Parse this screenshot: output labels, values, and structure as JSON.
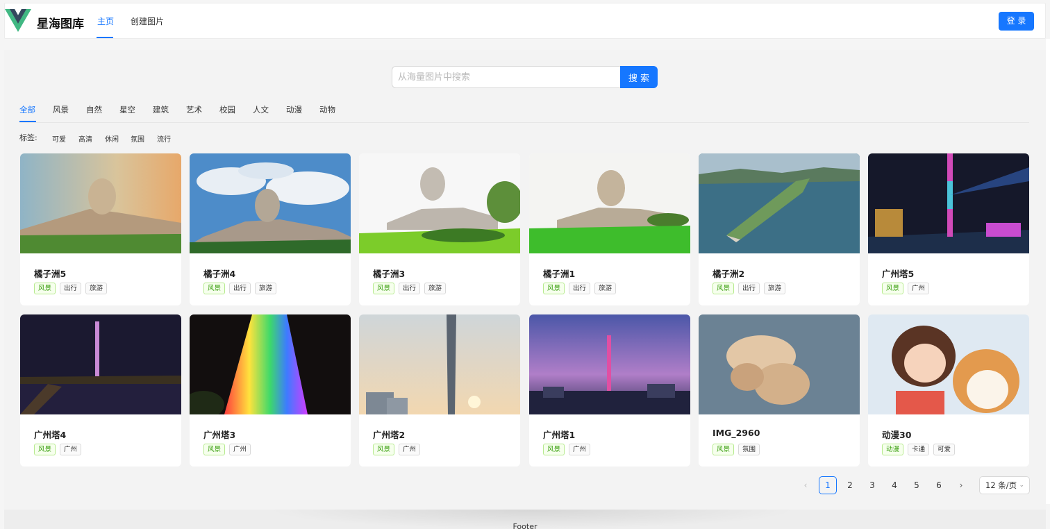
{
  "header": {
    "brand": "星海图库",
    "nav": [
      "主页",
      "创建图片"
    ],
    "login_label": "登 录"
  },
  "search": {
    "placeholder": "从海量图片中搜索",
    "button_label": "搜 索"
  },
  "categories": [
    "全部",
    "风景",
    "自然",
    "星空",
    "建筑",
    "艺术",
    "校园",
    "人文",
    "动漫",
    "动物"
  ],
  "tag_filter": {
    "label": "标签:",
    "tags": [
      "可爱",
      "高清",
      "休闲",
      "氛围",
      "流行"
    ]
  },
  "cards": [
    {
      "title": "橘子洲5",
      "tags": [
        "风景",
        "出行",
        "旅游"
      ]
    },
    {
      "title": "橘子洲4",
      "tags": [
        "风景",
        "出行",
        "旅游"
      ]
    },
    {
      "title": "橘子洲3",
      "tags": [
        "风景",
        "出行",
        "旅游"
      ]
    },
    {
      "title": "橘子洲1",
      "tags": [
        "风景",
        "出行",
        "旅游"
      ]
    },
    {
      "title": "橘子洲2",
      "tags": [
        "风景",
        "出行",
        "旅游"
      ]
    },
    {
      "title": "广州塔5",
      "tags": [
        "风景",
        "广州"
      ]
    },
    {
      "title": "广州塔4",
      "tags": [
        "风景",
        "广州"
      ]
    },
    {
      "title": "广州塔3",
      "tags": [
        "风景",
        "广州"
      ]
    },
    {
      "title": "广州塔2",
      "tags": [
        "风景",
        "广州"
      ]
    },
    {
      "title": "广州塔1",
      "tags": [
        "风景",
        "广州"
      ]
    },
    {
      "title": "IMG_2960",
      "tags": [
        "风景",
        "氛围"
      ]
    },
    {
      "title": "动漫30",
      "tags": [
        "动漫",
        "卡通",
        "可爱"
      ]
    }
  ],
  "pagination": {
    "prev": "‹",
    "next": "›",
    "pages": [
      "1",
      "2",
      "3",
      "4",
      "5",
      "6"
    ],
    "current": "1",
    "page_size": "12 条/页"
  },
  "footer": {
    "text": "Footer"
  },
  "colors": {
    "accent": "#1677ff",
    "tag_green": "#389e0d"
  },
  "icons": {
    "logo": "vue-logo-icon",
    "size_chevron": "chevron-down-icon"
  }
}
